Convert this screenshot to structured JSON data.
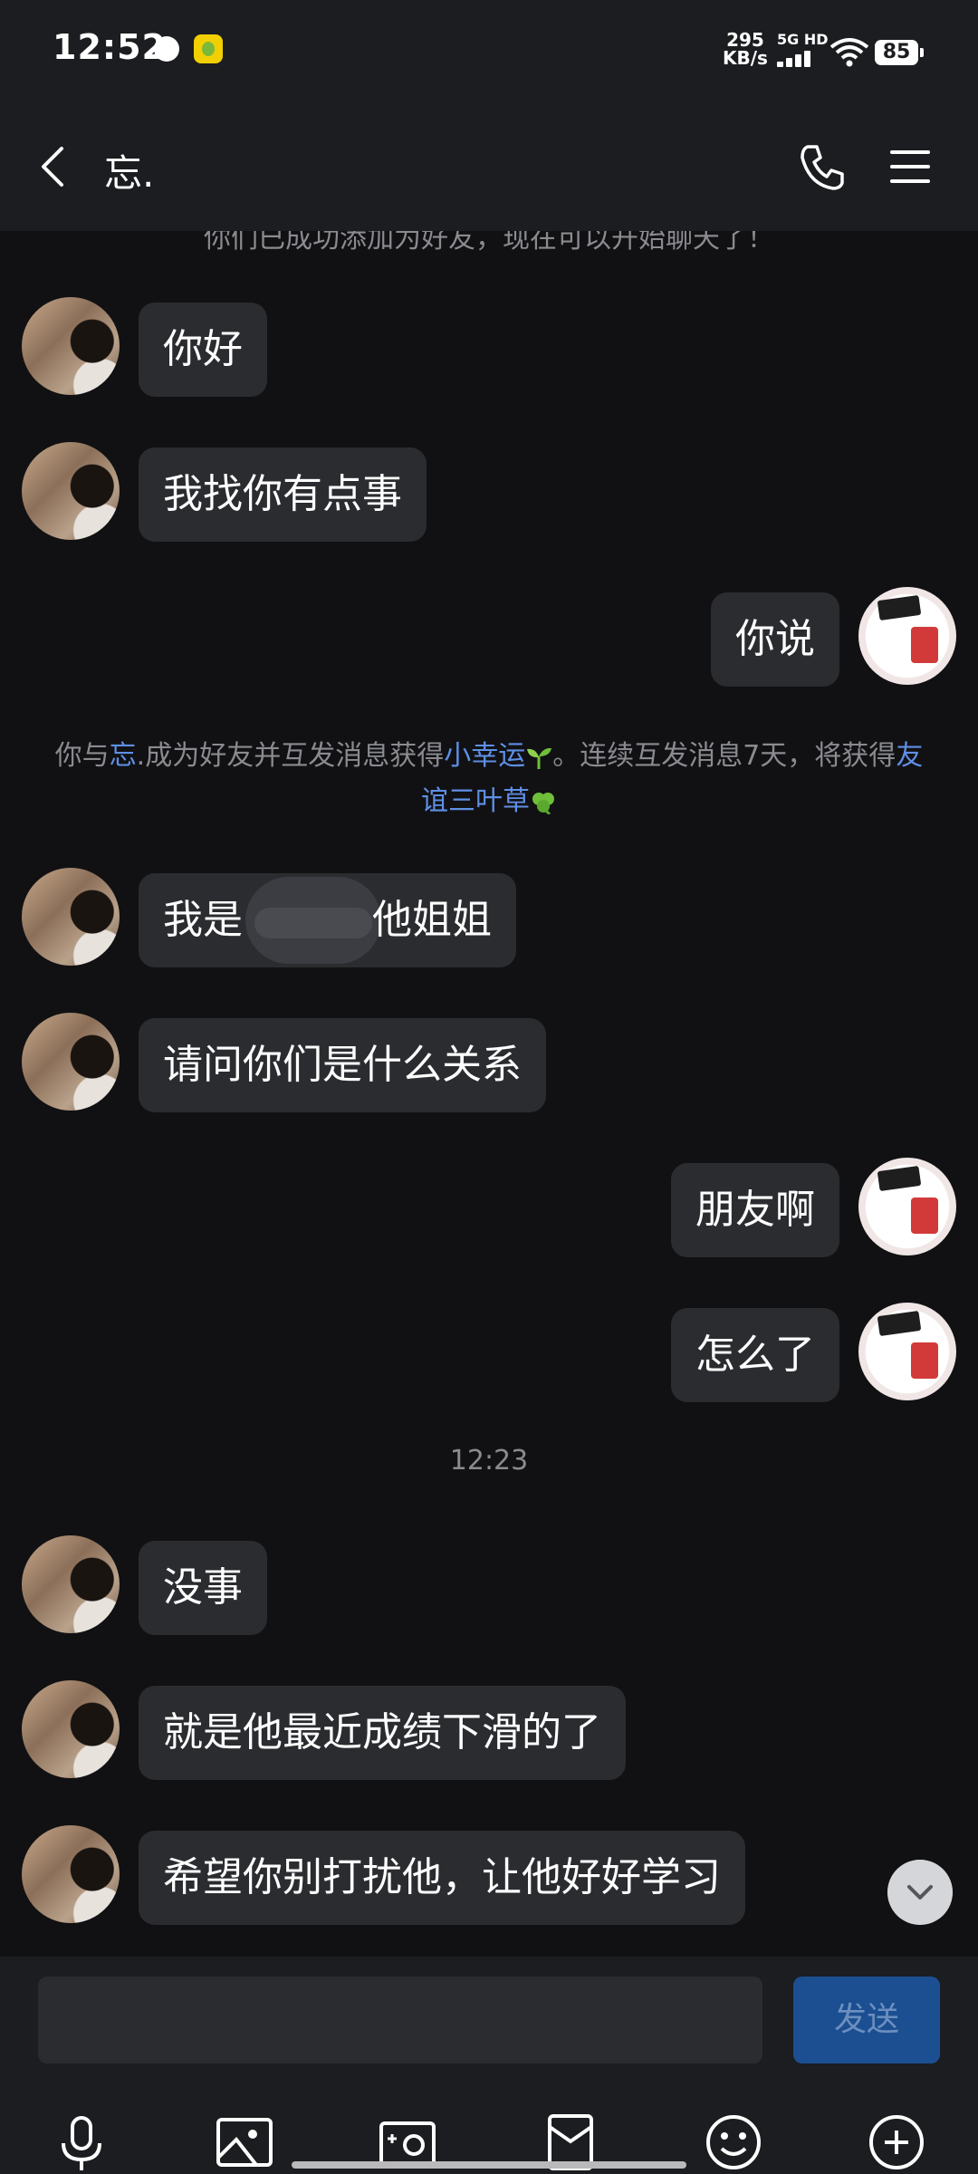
{
  "status_bar": {
    "time": "12:52",
    "net_speed_value": "295",
    "net_speed_unit": "KB/s",
    "network": "5G HD",
    "battery": "85"
  },
  "header": {
    "back_icon": "chevron-left-icon",
    "title": "忘.",
    "call_icon": "phone-icon",
    "menu_icon": "hamburger-menu-icon"
  },
  "system_top": "你们已成功添加为好友，现在可以开始聊天了！",
  "messages": [
    {
      "side": "left",
      "text": "你好"
    },
    {
      "side": "left",
      "text": "我找你有点事"
    },
    {
      "side": "right",
      "text": "你说"
    },
    {
      "side": "left",
      "text": "我是",
      "text_after": "他姐姐"
    },
    {
      "side": "left",
      "text": "请问你们是什么关系"
    },
    {
      "side": "right",
      "text": "朋友啊"
    },
    {
      "side": "right",
      "text": "怎么了"
    },
    {
      "side": "left",
      "text": "没事"
    },
    {
      "side": "left",
      "text": "就是他最近成绩下滑的了"
    },
    {
      "side": "left",
      "text": "希望你别打扰他，让他好好学习"
    }
  ],
  "notice": {
    "p1": "你与",
    "name": "忘",
    "p2": ".成为好友并互发消息获得",
    "luck": "小幸运",
    "p3": "。连续互发消息7天，将获得",
    "clover": "友谊三叶草"
  },
  "timestamp": "12:23",
  "input": {
    "placeholder": "",
    "send_label": "发送"
  },
  "toolbar_icons": [
    "microphone-icon",
    "image-icon",
    "camera-icon",
    "red-envelope-icon",
    "emoji-icon",
    "plus-icon"
  ]
}
